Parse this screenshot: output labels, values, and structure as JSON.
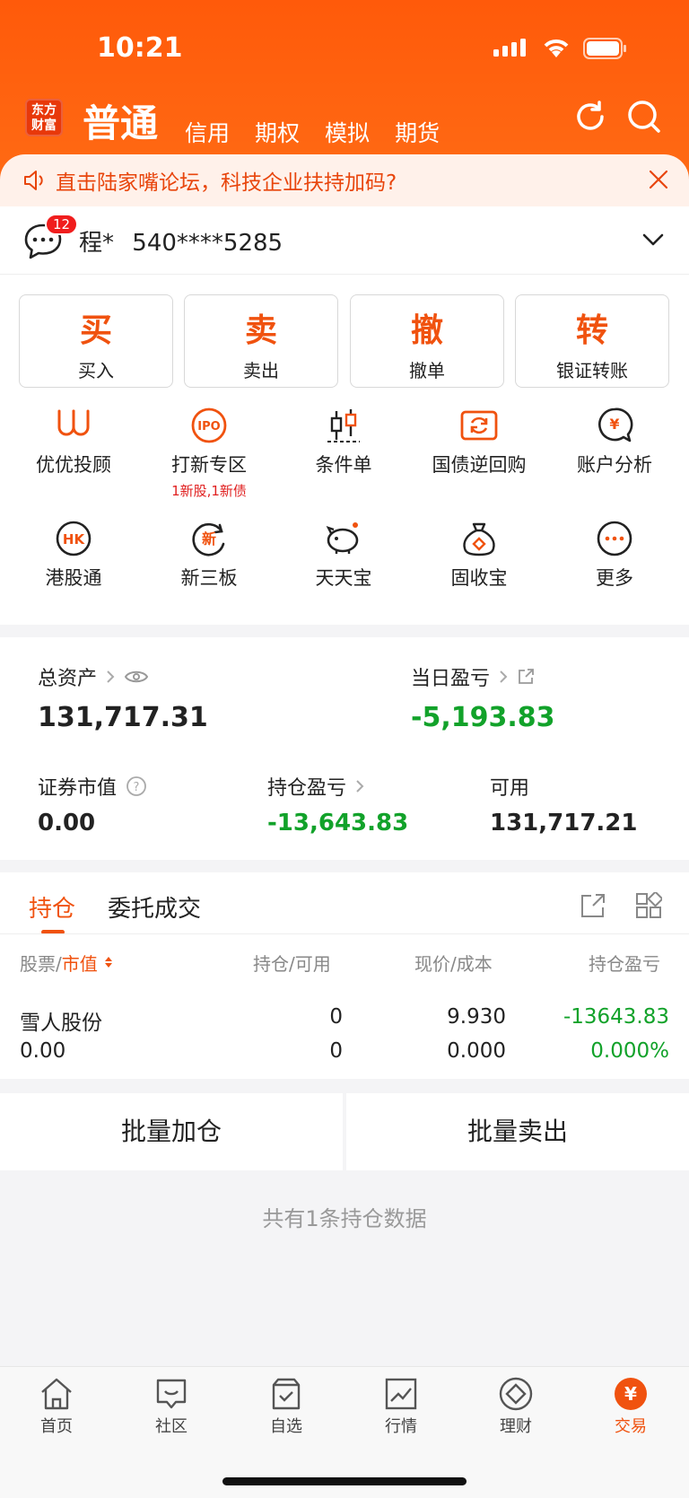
{
  "status": {
    "time": "10:21"
  },
  "header": {
    "logo": [
      "东方",
      "财富"
    ],
    "tabs": [
      {
        "label": "普通",
        "active": true
      },
      {
        "label": "信用"
      },
      {
        "label": "期权"
      },
      {
        "label": "模拟"
      },
      {
        "label": "期货"
      }
    ]
  },
  "notice": {
    "text": "直击陆家嘴论坛，科技企业扶持加码?"
  },
  "account": {
    "name": "程*",
    "number": "540****5285",
    "message_count": "12"
  },
  "trade_buttons": [
    {
      "big": "买",
      "small": "买入"
    },
    {
      "big": "卖",
      "small": "卖出"
    },
    {
      "big": "撤",
      "small": "撤单"
    },
    {
      "big": "转",
      "small": "银证转账"
    }
  ],
  "features": [
    {
      "label": "优优投顾",
      "icon": "uu-icon"
    },
    {
      "label": "打新专区",
      "sub": "1新股,1新债",
      "icon": "ipo-icon"
    },
    {
      "label": "条件单",
      "icon": "candlestick-icon"
    },
    {
      "label": "国债逆回购",
      "icon": "repo-icon"
    },
    {
      "label": "账户分析",
      "icon": "yen-chat-icon"
    },
    {
      "label": "港股通",
      "icon": "hk-icon"
    },
    {
      "label": "新三板",
      "icon": "new-icon"
    },
    {
      "label": "天天宝",
      "icon": "piggy-icon"
    },
    {
      "label": "固收宝",
      "icon": "moneybag-icon"
    },
    {
      "label": "更多",
      "icon": "more-icon"
    }
  ],
  "assets": {
    "total_label": "总资产",
    "total_value": "131,717.31",
    "daily_pl_label": "当日盈亏",
    "daily_pl_value": "-5,193.83",
    "market_value_label": "证券市值",
    "market_value": "0.00",
    "position_pl_label": "持仓盈亏",
    "position_pl_value": "-13,643.83",
    "available_label": "可用",
    "available_value": "131,717.21"
  },
  "positions": {
    "tabs": [
      "持仓",
      "委托成交"
    ],
    "headers": {
      "stock": "股票",
      "sep1": "/",
      "mv": "市值",
      "hold": "持仓/可用",
      "price": "现价/成本",
      "pl": "持仓盈亏"
    },
    "rows": [
      {
        "name": "雪人股份",
        "market_value": "0.00",
        "hold": "0",
        "available": "0",
        "price": "9.930",
        "cost": "0.000",
        "pl": "-13643.83",
        "pl_pct": "0.000%"
      }
    ]
  },
  "bulk": {
    "add": "批量加仓",
    "sell": "批量卖出"
  },
  "summary": "共有1条持仓数据",
  "tabbar": [
    {
      "label": "首页",
      "icon": "home-icon"
    },
    {
      "label": "社区",
      "icon": "community-icon"
    },
    {
      "label": "自选",
      "icon": "watchlist-icon"
    },
    {
      "label": "行情",
      "icon": "market-icon"
    },
    {
      "label": "理财",
      "icon": "wealth-icon"
    },
    {
      "label": "交易",
      "icon": "trade-icon",
      "active": true
    }
  ],
  "colors": {
    "accent": "#ff5a0a",
    "green": "#12a22a",
    "red": "#f01d1d"
  }
}
